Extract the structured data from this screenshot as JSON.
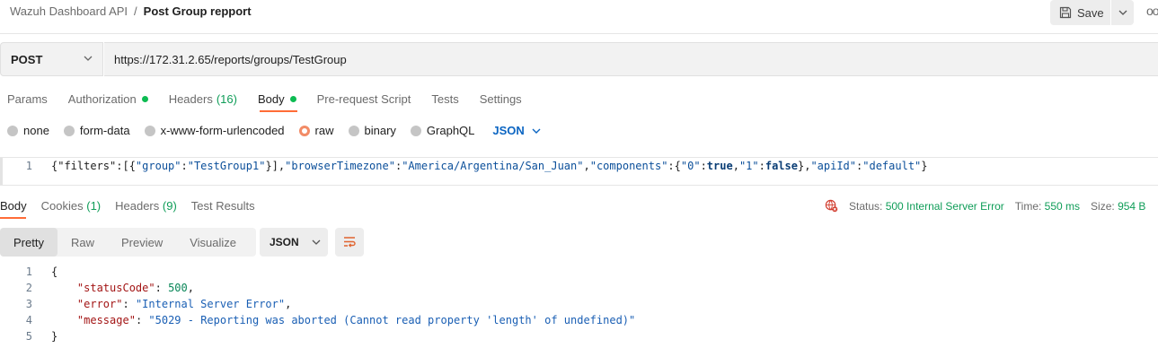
{
  "header": {
    "collection": "Wazuh Dashboard API",
    "separator": "/",
    "request_name": "Post Group repport",
    "save_label": "Save",
    "more_label": "ooo"
  },
  "request": {
    "method": "POST",
    "url": "https://172.31.2.65/reports/groups/TestGroup"
  },
  "request_tabs": [
    {
      "label": "Params"
    },
    {
      "label": "Authorization",
      "dot": true
    },
    {
      "label": "Headers",
      "count": "(16)"
    },
    {
      "label": "Body",
      "dot": true,
      "active": true
    },
    {
      "label": "Pre-request Script"
    },
    {
      "label": "Tests"
    },
    {
      "label": "Settings"
    }
  ],
  "body_types": [
    "none",
    "form-data",
    "x-www-form-urlencoded",
    "raw",
    "binary",
    "GraphQL"
  ],
  "body_type_selected": "raw",
  "body_format": "JSON",
  "request_body": {
    "line_number": "1",
    "segments": [
      {
        "t": "{\"filters\":[{",
        "c": "punc"
      },
      {
        "t": "\"group\"",
        "c": "str"
      },
      {
        "t": ":",
        "c": "punc"
      },
      {
        "t": "\"TestGroup1\"",
        "c": "str"
      },
      {
        "t": "}],",
        "c": "punc"
      },
      {
        "t": "\"browserTimezone\"",
        "c": "str"
      },
      {
        "t": ":",
        "c": "punc"
      },
      {
        "t": "\"America/Argentina/San_Juan\"",
        "c": "str"
      },
      {
        "t": ",",
        "c": "punc"
      },
      {
        "t": "\"components\"",
        "c": "str"
      },
      {
        "t": ":{",
        "c": "punc"
      },
      {
        "t": "\"0\"",
        "c": "str"
      },
      {
        "t": ":",
        "c": "punc"
      },
      {
        "t": "true",
        "c": "kw"
      },
      {
        "t": ",",
        "c": "punc"
      },
      {
        "t": "\"1\"",
        "c": "str"
      },
      {
        "t": ":",
        "c": "punc"
      },
      {
        "t": "false",
        "c": "kw"
      },
      {
        "t": "},",
        "c": "punc"
      },
      {
        "t": "\"apiId\"",
        "c": "str"
      },
      {
        "t": ":",
        "c": "punc"
      },
      {
        "t": "\"default\"",
        "c": "str"
      },
      {
        "t": "}",
        "c": "punc"
      }
    ]
  },
  "response_tabs": [
    {
      "label": "Body",
      "active": true
    },
    {
      "label": "Cookies",
      "count": "(1)"
    },
    {
      "label": "Headers",
      "count": "(9)"
    },
    {
      "label": "Test Results"
    }
  ],
  "response_meta": {
    "status_label": "Status:",
    "status_value": "500 Internal Server Error",
    "time_label": "Time:",
    "time_value": "550 ms",
    "size_label": "Size:",
    "size_value": "954 B"
  },
  "view_modes": [
    "Pretty",
    "Raw",
    "Preview",
    "Visualize"
  ],
  "view_mode_selected": "Pretty",
  "response_format": "JSON",
  "response_body": [
    {
      "n": "1",
      "segments": [
        {
          "t": "{",
          "c": "punc"
        }
      ]
    },
    {
      "n": "2",
      "segments": [
        {
          "t": "    ",
          "c": "punc"
        },
        {
          "t": "\"statusCode\"",
          "c": "key"
        },
        {
          "t": ": ",
          "c": "punc"
        },
        {
          "t": "500",
          "c": "num"
        },
        {
          "t": ",",
          "c": "punc"
        }
      ]
    },
    {
      "n": "3",
      "segments": [
        {
          "t": "    ",
          "c": "punc"
        },
        {
          "t": "\"error\"",
          "c": "key"
        },
        {
          "t": ": ",
          "c": "punc"
        },
        {
          "t": "\"Internal Server Error\"",
          "c": "strp"
        },
        {
          "t": ",",
          "c": "punc"
        }
      ]
    },
    {
      "n": "4",
      "segments": [
        {
          "t": "    ",
          "c": "punc"
        },
        {
          "t": "\"message\"",
          "c": "key"
        },
        {
          "t": ": ",
          "c": "punc"
        },
        {
          "t": "\"5029 - Reporting was aborted (Cannot read property 'length' of undefined)\"",
          "c": "strp"
        }
      ]
    },
    {
      "n": "5",
      "segments": [
        {
          "t": "}",
          "c": "punc"
        }
      ]
    }
  ],
  "colors": {
    "accent": "#ff6c37",
    "success": "#0f9d58",
    "link": "#0b65c2"
  }
}
